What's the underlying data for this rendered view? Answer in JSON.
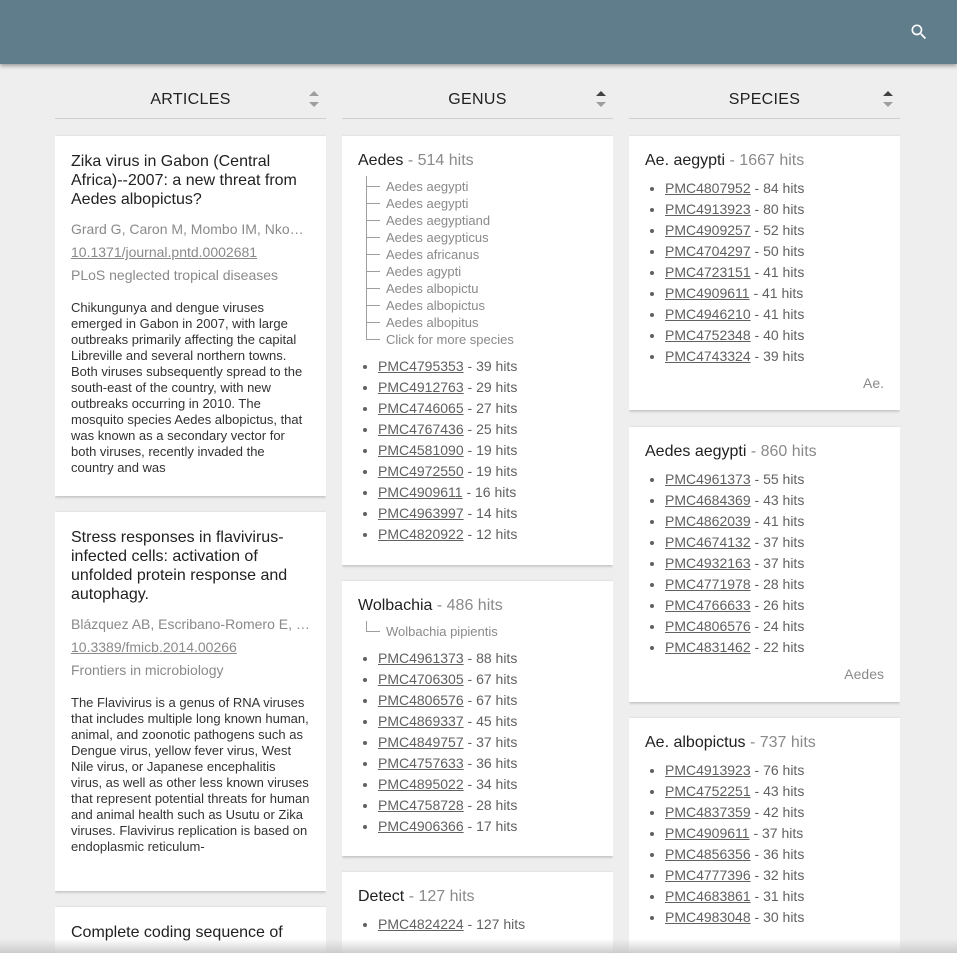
{
  "columns": {
    "articles": "ARTICLES",
    "genus": "GENUS",
    "species": "SPECIES"
  },
  "articles": [
    {
      "title": "Zika virus in Gabon (Central Africa)--2007: a new threat from Aedes albopictus?",
      "authors": "Grard G, Caron M, Mombo IM, Nkoghe D",
      "doi": "10.1371/journal.pntd.0002681",
      "journal": "PLoS neglected tropical diseases",
      "abstract": "Chikungunya and dengue viruses emerged in Gabon in 2007, with large outbreaks primarily affecting the capital Libreville and several northern towns. Both viruses subsequently spread to the south-east of the country, with new outbreaks occurring in 2010. The mosquito species Aedes albopictus, that was known as a secondary vector for both viruses, recently invaded the country and was"
    },
    {
      "title": "Stress responses in flavivirus-infected cells: activation of unfolded protein response and autophagy.",
      "authors": "Blázquez AB, Escribano-Romero E, Merino-Ramos T",
      "doi": "10.3389/fmicb.2014.00266",
      "journal": "Frontiers in microbiology",
      "abstract": "The Flavivirus is a genus of RNA viruses that includes multiple long known human, animal, and zoonotic pathogens such as Dengue virus, yellow fever virus, West Nile virus, or Japanese encephalitis virus, as well as other less known viruses that represent potential threats for human and animal health such as Usutu or Zika viruses. Flavivirus replication is based on endoplasmic reticulum-"
    },
    {
      "title": "Complete coding sequence of"
    }
  ],
  "genus": [
    {
      "name": "Aedes",
      "hits": "- 514 hits",
      "tree": [
        "Aedes aegypti",
        "Aedes aegypti",
        "Aedes aegyptiand",
        "Aedes aegypticus",
        "Aedes africanus",
        "Aedes agypti",
        "Aedes albopictu",
        "Aedes albopictus",
        "Aedes albopitus",
        "Click for more species"
      ],
      "pmcs": [
        {
          "id": "PMC4795353",
          "hits": " - 39 hits"
        },
        {
          "id": "PMC4912763",
          "hits": " - 29 hits"
        },
        {
          "id": "PMC4746065",
          "hits": " - 27 hits"
        },
        {
          "id": "PMC4767436",
          "hits": " - 25 hits"
        },
        {
          "id": "PMC4581090",
          "hits": " - 19 hits"
        },
        {
          "id": "PMC4972550",
          "hits": " - 19 hits"
        },
        {
          "id": "PMC4909611",
          "hits": " - 16 hits"
        },
        {
          "id": "PMC4963997",
          "hits": " - 14 hits"
        },
        {
          "id": "PMC4820922",
          "hits": " - 12 hits"
        }
      ]
    },
    {
      "name": "Wolbachia",
      "hits": "- 486 hits",
      "tree": [
        "Wolbachia pipientis"
      ],
      "pmcs": [
        {
          "id": "PMC4961373",
          "hits": " - 88 hits"
        },
        {
          "id": "PMC4706305",
          "hits": " - 67 hits"
        },
        {
          "id": "PMC4806576",
          "hits": " - 67 hits"
        },
        {
          "id": "PMC4869337",
          "hits": " - 45 hits"
        },
        {
          "id": "PMC4849757",
          "hits": " - 37 hits"
        },
        {
          "id": "PMC4757633",
          "hits": " - 36 hits"
        },
        {
          "id": "PMC4895022",
          "hits": " - 34 hits"
        },
        {
          "id": "PMC4758728",
          "hits": " - 28 hits"
        },
        {
          "id": "PMC4906366",
          "hits": " - 17 hits"
        }
      ]
    },
    {
      "name": "Detect",
      "hits": "- 127 hits",
      "pmcs": [
        {
          "id": "PMC4824224",
          "hits": " - 127 hits"
        }
      ]
    }
  ],
  "species": [
    {
      "name": "Ae. aegypti",
      "hits": "- 1667 hits",
      "footer": "Ae.",
      "pmcs": [
        {
          "id": "PMC4807952",
          "hits": " - 84 hits"
        },
        {
          "id": "PMC4913923",
          "hits": " - 80 hits"
        },
        {
          "id": "PMC4909257",
          "hits": " - 52 hits"
        },
        {
          "id": "PMC4704297",
          "hits": " - 50 hits"
        },
        {
          "id": "PMC4723151",
          "hits": " - 41 hits"
        },
        {
          "id": "PMC4909611",
          "hits": " - 41 hits"
        },
        {
          "id": "PMC4946210",
          "hits": " - 41 hits"
        },
        {
          "id": "PMC4752348",
          "hits": " - 40 hits"
        },
        {
          "id": "PMC4743324",
          "hits": " - 39 hits"
        }
      ]
    },
    {
      "name": "Aedes aegypti",
      "hits": "- 860 hits",
      "footer": "Aedes",
      "pmcs": [
        {
          "id": "PMC4961373",
          "hits": " - 55 hits"
        },
        {
          "id": "PMC4684369",
          "hits": " - 43 hits"
        },
        {
          "id": "PMC4862039",
          "hits": " - 41 hits"
        },
        {
          "id": "PMC4674132",
          "hits": " - 37 hits"
        },
        {
          "id": "PMC4932163",
          "hits": " - 37 hits"
        },
        {
          "id": "PMC4771978",
          "hits": " - 28 hits"
        },
        {
          "id": "PMC4766633",
          "hits": " - 26 hits"
        },
        {
          "id": "PMC4806576",
          "hits": " - 24 hits"
        },
        {
          "id": "PMC4831462",
          "hits": " - 22 hits"
        }
      ]
    },
    {
      "name": "Ae. albopictus",
      "hits": "- 737 hits",
      "pmcs": [
        {
          "id": "PMC4913923",
          "hits": " - 76 hits"
        },
        {
          "id": "PMC4752251",
          "hits": " - 43 hits"
        },
        {
          "id": "PMC4837359",
          "hits": " - 42 hits"
        },
        {
          "id": "PMC4909611",
          "hits": " - 37 hits"
        },
        {
          "id": "PMC4856356",
          "hits": " - 36 hits"
        },
        {
          "id": "PMC4777396",
          "hits": " - 32 hits"
        },
        {
          "id": "PMC4683861",
          "hits": " - 31 hits"
        },
        {
          "id": "PMC4983048",
          "hits": " - 30 hits"
        }
      ]
    }
  ],
  "icons": {
    "search": "search-icon",
    "sort": "sort-icon"
  },
  "colors": {
    "toolbar": "#607d8b",
    "background": "#eeeeee",
    "card": "#ffffff"
  }
}
